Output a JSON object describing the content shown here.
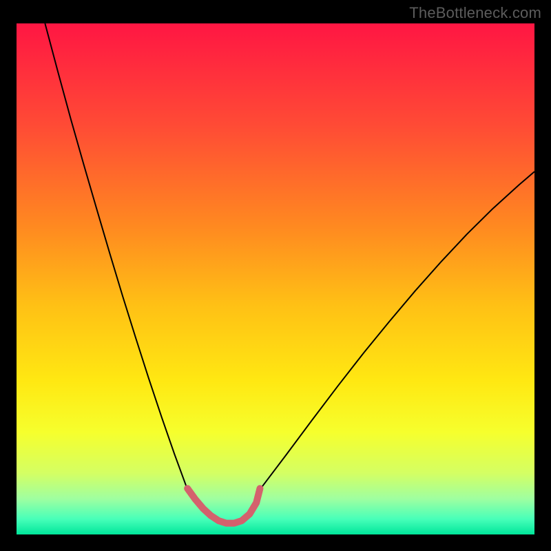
{
  "watermark": {
    "text": "TheBottleneck.com"
  },
  "chart_data": {
    "type": "line",
    "title": "",
    "xlabel": "",
    "ylabel": "",
    "xlim": [
      0,
      1
    ],
    "ylim": [
      0,
      1
    ],
    "grid": false,
    "legend": false,
    "background_gradient": {
      "stops": [
        {
          "offset": 0.0,
          "color": "#ff1643"
        },
        {
          "offset": 0.2,
          "color": "#ff4b35"
        },
        {
          "offset": 0.4,
          "color": "#ff8a20"
        },
        {
          "offset": 0.55,
          "color": "#ffc015"
        },
        {
          "offset": 0.7,
          "color": "#ffe812"
        },
        {
          "offset": 0.8,
          "color": "#f6ff2d"
        },
        {
          "offset": 0.88,
          "color": "#d4ff63"
        },
        {
          "offset": 0.93,
          "color": "#9fffa0"
        },
        {
          "offset": 0.97,
          "color": "#47ffb9"
        },
        {
          "offset": 1.0,
          "color": "#00e69a"
        }
      ]
    },
    "series": [
      {
        "name": "curve-left",
        "stroke": "#000000",
        "stroke_width": 2,
        "x": [
          0.055,
          0.08,
          0.105,
          0.13,
          0.155,
          0.18,
          0.205,
          0.23,
          0.255,
          0.28,
          0.305,
          0.33
        ],
        "y": [
          1.0,
          0.905,
          0.812,
          0.723,
          0.636,
          0.55,
          0.466,
          0.385,
          0.306,
          0.23,
          0.157,
          0.088
        ]
      },
      {
        "name": "curve-right",
        "stroke": "#000000",
        "stroke_width": 2,
        "x": [
          0.47,
          0.52,
          0.57,
          0.62,
          0.67,
          0.72,
          0.77,
          0.82,
          0.87,
          0.92,
          0.97,
          1.0
        ],
        "y": [
          0.088,
          0.155,
          0.223,
          0.29,
          0.355,
          0.417,
          0.477,
          0.534,
          0.588,
          0.638,
          0.684,
          0.71
        ]
      },
      {
        "name": "bottom-accent",
        "stroke": "#d4616d",
        "stroke_width": 10,
        "linecap": "round",
        "x": [
          0.33,
          0.345,
          0.36,
          0.375,
          0.39,
          0.405,
          0.42,
          0.435,
          0.45,
          0.463,
          0.47
        ],
        "y": [
          0.09,
          0.069,
          0.051,
          0.037,
          0.027,
          0.022,
          0.022,
          0.027,
          0.04,
          0.062,
          0.09
        ]
      }
    ]
  }
}
